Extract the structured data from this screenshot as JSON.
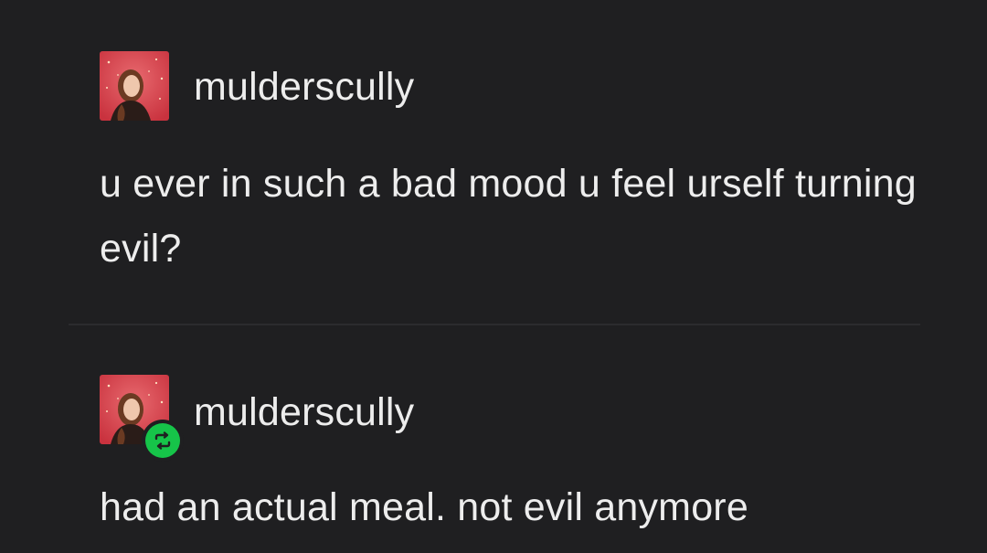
{
  "posts": [
    {
      "username": "mulderscully",
      "avatar_icon": "user-avatar-photo",
      "text": "u ever in such a bad mood u feel urself turning evil?"
    },
    {
      "username": "mulderscully",
      "avatar_icon": "user-avatar-photo",
      "badge_icon": "reblog-icon",
      "text": "had an actual meal. not evil anymore"
    }
  ],
  "colors": {
    "background": "#1f1f21",
    "text": "#ededed",
    "reblog_green": "#16c449",
    "avatar_red": "#d9444f"
  }
}
